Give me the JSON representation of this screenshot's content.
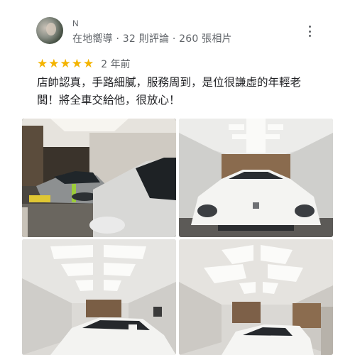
{
  "reviewer": {
    "name": "N",
    "meta": "在地嚮導 · 32 則評論 · 260 張相片"
  },
  "review": {
    "stars": 5,
    "star_glyph": "★",
    "date": "2 年前",
    "text_line1": "店帥認真，手路細膩，服務周到，是位很謙虛的年輕老",
    "text_line2": "闆！將全車交給他，很放心！"
  },
  "photos": [
    {
      "subject": "gray sports car with green stripe in garage"
    },
    {
      "subject": "white Tesla front in bright garage"
    },
    {
      "subject": "garage ceiling light panels with white car"
    },
    {
      "subject": "garage ceiling light panels with white car"
    }
  ],
  "colors": {
    "star": "#f4b400",
    "meta_text": "#5f6368",
    "body_text": "#202124"
  },
  "icons": {
    "more": "more-vertical-icon"
  }
}
